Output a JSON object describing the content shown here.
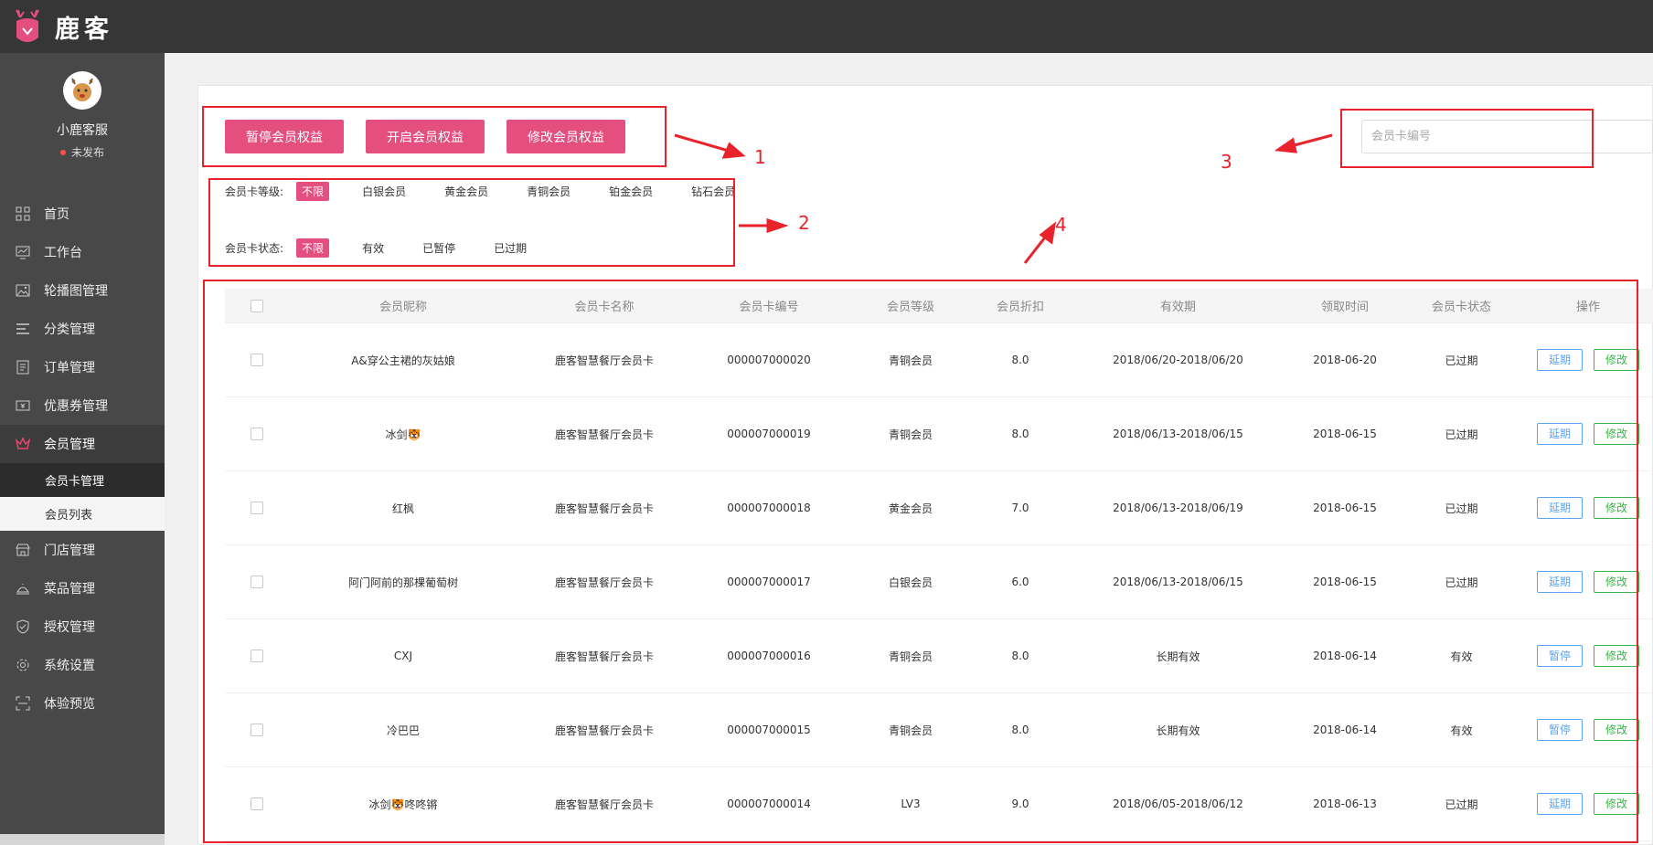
{
  "app": {
    "logo_text": "鹿客"
  },
  "profile": {
    "name": "小鹿客服",
    "status": "未发布"
  },
  "menu": [
    {
      "label": "首页",
      "icon": "grid-icon"
    },
    {
      "label": "工作台",
      "icon": "monitor-icon"
    },
    {
      "label": "轮播图管理",
      "icon": "image-icon"
    },
    {
      "label": "分类管理",
      "icon": "list-icon"
    },
    {
      "label": "订单管理",
      "icon": "document-icon"
    },
    {
      "label": "优惠券管理",
      "icon": "coupon-icon"
    },
    {
      "label": "会员管理",
      "icon": "crown-icon"
    },
    {
      "label": "门店管理",
      "icon": "store-icon"
    },
    {
      "label": "菜品管理",
      "icon": "dish-cover-icon"
    },
    {
      "label": "授权管理",
      "icon": "shield-icon"
    },
    {
      "label": "系统设置",
      "icon": "gear-icon"
    },
    {
      "label": "体验预览",
      "icon": "scan-icon"
    }
  ],
  "submenu": [
    {
      "label": "会员卡管理"
    },
    {
      "label": "会员列表"
    }
  ],
  "actions": {
    "pause": "暂停会员权益",
    "enable": "开启会员权益",
    "modify": "修改会员权益"
  },
  "search": {
    "placeholder": "会员卡编号",
    "value": ""
  },
  "filters": {
    "level": {
      "label": "会员卡等级:",
      "options": [
        "不限",
        "白银会员",
        "黄金会员",
        "青铜会员",
        "铂金会员",
        "钻石会员"
      ],
      "selected": "不限"
    },
    "status": {
      "label": "会员卡状态:",
      "options": [
        "不限",
        "有效",
        "已暂停",
        "已过期"
      ],
      "selected": "不限"
    }
  },
  "annotations": [
    "1",
    "2",
    "3",
    "4"
  ],
  "table": {
    "columns": [
      "会员昵称",
      "会员卡名称",
      "会员卡编号",
      "会员等级",
      "会员折扣",
      "有效期",
      "领取时间",
      "会员卡状态",
      "操作"
    ],
    "rows": [
      {
        "nickname": "A&穿公主裙的灰姑娘",
        "card_name": "鹿客智慧餐厅会员卡",
        "card_no": "000007000020",
        "level": "青铜会员",
        "discount": "8.0",
        "validity": "2018/06/20-2018/06/20",
        "received": "2018-06-20",
        "status": "已过期",
        "op1": "延期",
        "op2": "修改"
      },
      {
        "nickname": "冰剑🐯",
        "card_name": "鹿客智慧餐厅会员卡",
        "card_no": "000007000019",
        "level": "青铜会员",
        "discount": "8.0",
        "validity": "2018/06/13-2018/06/15",
        "received": "2018-06-15",
        "status": "已过期",
        "op1": "延期",
        "op2": "修改"
      },
      {
        "nickname": "红枫",
        "card_name": "鹿客智慧餐厅会员卡",
        "card_no": "000007000018",
        "level": "黄金会员",
        "discount": "7.0",
        "validity": "2018/06/13-2018/06/19",
        "received": "2018-06-15",
        "status": "已过期",
        "op1": "延期",
        "op2": "修改"
      },
      {
        "nickname": "阿门阿前的那棵葡萄树",
        "card_name": "鹿客智慧餐厅会员卡",
        "card_no": "000007000017",
        "level": "白银会员",
        "discount": "6.0",
        "validity": "2018/06/13-2018/06/15",
        "received": "2018-06-15",
        "status": "已过期",
        "op1": "延期",
        "op2": "修改"
      },
      {
        "nickname": "CXJ",
        "card_name": "鹿客智慧餐厅会员卡",
        "card_no": "000007000016",
        "level": "青铜会员",
        "discount": "8.0",
        "validity": "长期有效",
        "received": "2018-06-14",
        "status": "有效",
        "op1": "暂停",
        "op2": "修改"
      },
      {
        "nickname": "冷巴巴",
        "card_name": "鹿客智慧餐厅会员卡",
        "card_no": "000007000015",
        "level": "青铜会员",
        "discount": "8.0",
        "validity": "长期有效",
        "received": "2018-06-14",
        "status": "有效",
        "op1": "暂停",
        "op2": "修改"
      },
      {
        "nickname": "冰剑🐯咚咚锵",
        "card_name": "鹿客智慧餐厅会员卡",
        "card_no": "000007000014",
        "level": "LV3",
        "discount": "9.0",
        "validity": "2018/06/05-2018/06/12",
        "received": "2018-06-13",
        "status": "已过期",
        "op1": "延期",
        "op2": "修改"
      }
    ]
  },
  "colors": {
    "accent": "#e44f7f",
    "topbar": "#363636",
    "sidebar": "#484848",
    "annotation": "#e8232b",
    "op_blue": "#5aa4f2",
    "op_green": "#3ab34a"
  }
}
